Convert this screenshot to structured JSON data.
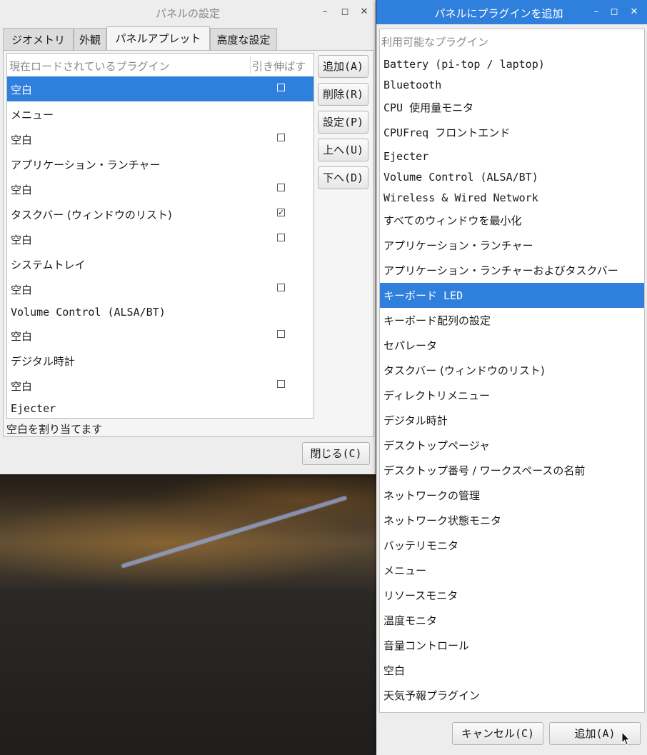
{
  "panel_settings": {
    "title": "パネルの設定",
    "tabs": [
      {
        "label": "ジオメトリ"
      },
      {
        "label": "外観"
      },
      {
        "label": "パネルアプレット"
      },
      {
        "label": "高度な設定"
      }
    ],
    "list_header": {
      "name": "現在ロードされているプラグイン",
      "stretch": "引き伸ばす"
    },
    "plugins": [
      {
        "name": "空白",
        "stretch": false,
        "has_check": true,
        "selected": true
      },
      {
        "name": "メニュー",
        "has_check": false
      },
      {
        "name": "空白",
        "stretch": false,
        "has_check": true
      },
      {
        "name": "アプリケーション・ランチャー",
        "has_check": false
      },
      {
        "name": "空白",
        "stretch": false,
        "has_check": true
      },
      {
        "name": "タスクバー (ウィンドウのリスト)",
        "stretch": true,
        "has_check": true
      },
      {
        "name": "空白",
        "stretch": false,
        "has_check": true
      },
      {
        "name": "システムトレイ",
        "has_check": false
      },
      {
        "name": "空白",
        "stretch": false,
        "has_check": true
      },
      {
        "name": "Volume Control (ALSA/BT)",
        "has_check": false
      },
      {
        "name": "空白",
        "stretch": false,
        "has_check": true
      },
      {
        "name": "デジタル時計",
        "has_check": false
      },
      {
        "name": "空白",
        "stretch": false,
        "has_check": true
      },
      {
        "name": "Ejecter",
        "has_check": false
      }
    ],
    "side_buttons": {
      "add": "追加(A)",
      "remove": "削除(R)",
      "preferences": "設定(P)",
      "up": "上へ(U)",
      "down": "下へ(D)"
    },
    "status": "空白を割り当てます",
    "close_button": "閉じる(C)"
  },
  "add_plugin": {
    "title": "パネルにプラグインを追加",
    "list_header": "利用可能なプラグイン",
    "plugins": [
      {
        "name": "Battery (pi-top / laptop)"
      },
      {
        "name": "Bluetooth"
      },
      {
        "name": "CPU 使用量モニタ"
      },
      {
        "name": "CPUFreq フロントエンド"
      },
      {
        "name": "Ejecter"
      },
      {
        "name": "Volume Control (ALSA/BT)"
      },
      {
        "name": "Wireless & Wired Network"
      },
      {
        "name": "すべてのウィンドウを最小化"
      },
      {
        "name": "アプリケーション・ランチャー"
      },
      {
        "name": "アプリケーション・ランチャーおよびタスクバー"
      },
      {
        "name": "キーボード LED",
        "selected": true
      },
      {
        "name": "キーボード配列の設定"
      },
      {
        "name": "セパレータ"
      },
      {
        "name": "タスクバー (ウィンドウのリスト)"
      },
      {
        "name": "ディレクトリメニュー"
      },
      {
        "name": "デジタル時計"
      },
      {
        "name": "デスクトップページャ"
      },
      {
        "name": "デスクトップ番号 / ワークスペースの名前"
      },
      {
        "name": "ネットワークの管理"
      },
      {
        "name": "ネットワーク状態モニタ"
      },
      {
        "name": "バッテリモニタ"
      },
      {
        "name": "メニュー"
      },
      {
        "name": "リソースモニタ"
      },
      {
        "name": "温度モニタ"
      },
      {
        "name": "音量コントロール"
      },
      {
        "name": "空白"
      },
      {
        "name": "天気予報プラグイン"
      }
    ],
    "cancel_button": "キャンセル(C)",
    "add_button": "追加(A)"
  },
  "colors": {
    "selection": "#2f7fdd",
    "window_bg": "#ededed"
  }
}
